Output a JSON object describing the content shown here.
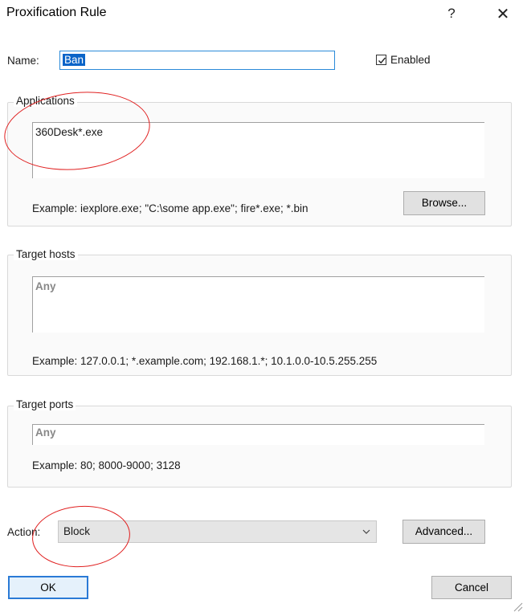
{
  "window": {
    "title": "Proxification Rule",
    "help_label": "?",
    "close_label": "✕"
  },
  "name": {
    "label": "Name:",
    "value": "Ban"
  },
  "enabled": {
    "label": "Enabled",
    "checked": true
  },
  "applications": {
    "group_title": "Applications",
    "value": "360Desk*.exe",
    "example": "Example: iexplore.exe; \"C:\\some app.exe\"; fire*.exe; *.bin",
    "browse_label": "Browse..."
  },
  "target_hosts": {
    "group_title": "Target hosts",
    "value": "Any",
    "example": "Example: 127.0.0.1; *.example.com; 192.168.1.*; 10.1.0.0-10.5.255.255"
  },
  "target_ports": {
    "group_title": "Target ports",
    "value": "Any",
    "example": "Example: 80; 8000-9000; 3128"
  },
  "action": {
    "label": "Action:",
    "selected": "Block",
    "advanced_label": "Advanced..."
  },
  "footer": {
    "ok_label": "OK",
    "cancel_label": "Cancel"
  },
  "colors": {
    "annotation": "#e02020",
    "accent": "#2a7ad6",
    "selection": "#0a64c8"
  },
  "icons": {
    "check": "check-icon",
    "dropdown": "chevron-down-icon",
    "close": "close-icon",
    "resize": "resize-grip-icon"
  }
}
